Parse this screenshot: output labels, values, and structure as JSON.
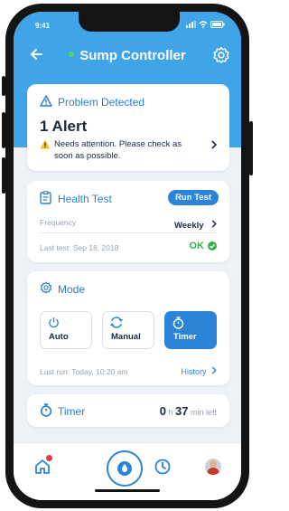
{
  "status_bar": {
    "time": "9:41"
  },
  "header": {
    "title": "Sump Controller"
  },
  "problem_card": {
    "title": "Problem Detected",
    "headline": "1 Alert",
    "message": "Needs attention. Please check as soon as possible."
  },
  "health_card": {
    "title": "Health Test",
    "run_button": "Run Test",
    "frequency_label": "Frequency",
    "frequency_value": "Weekly",
    "last_test_label": "Last test: Sep 18, 2018",
    "result": "OK"
  },
  "mode_card": {
    "title": "Mode",
    "options": [
      {
        "label": "Auto",
        "icon": "power-icon",
        "active": false
      },
      {
        "label": "Manual",
        "icon": "sync-icon",
        "active": false
      },
      {
        "label": "Timer",
        "icon": "stopwatch-icon",
        "active": true
      }
    ],
    "last_run": "Last run: Today, 10:20 am",
    "history_link": "History"
  },
  "timer_card": {
    "title": "Timer",
    "hours": "0",
    "hours_unit": "h",
    "minutes": "37",
    "minutes_unit": "min left"
  },
  "nav": {
    "items": [
      "home-icon",
      "water-drop-icon",
      "clock-icon",
      "profile-avatar"
    ]
  },
  "colors": {
    "header": "#3fa4e8",
    "accent": "#2b84d8",
    "ok": "#38b24a",
    "warning": "#f5c518",
    "notification": "#e8354a"
  }
}
